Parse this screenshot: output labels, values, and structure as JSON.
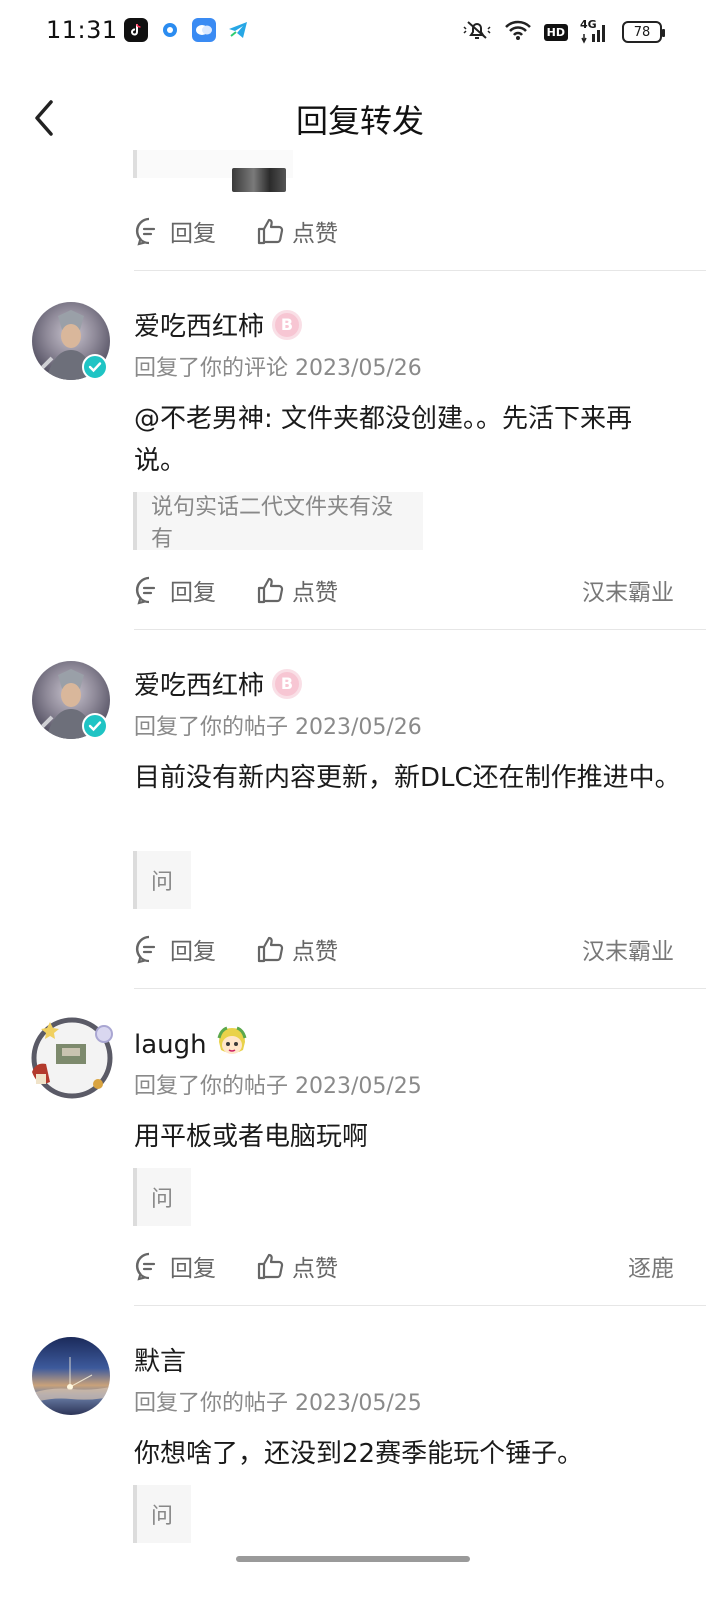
{
  "status_bar": {
    "time": "11:31",
    "network": "4G",
    "hd": "HD",
    "battery": "78",
    "app_icons": [
      "tiktok-icon",
      "browser-icon",
      "chat-icon",
      "telegram-icon"
    ]
  },
  "header": {
    "title": "回复转发"
  },
  "actions": {
    "reply_label": "回复",
    "like_label": "点赞"
  },
  "items": [
    {
      "username": "爱吃西红柿",
      "badge": "B",
      "verified": true,
      "meta": "回复了你的评论 2023/05/26",
      "content": "@不老男神: 文件夹都没创建。。先活下来再说。",
      "quote": "说句实话二代文件夹有没有",
      "source": "汉末霸业"
    },
    {
      "username": "爱吃西红柿",
      "badge": "B",
      "verified": true,
      "meta": "回复了你的帖子 2023/05/26",
      "content": "目前没有新内容更新，新DLC还在制作推进中。",
      "quote": "问",
      "source": "汉末霸业"
    },
    {
      "username": "laugh",
      "verified": false,
      "meta": "回复了你的帖子 2023/05/25",
      "content": "用平板或者电脑玩啊",
      "quote": "问",
      "source": "逐鹿"
    },
    {
      "username": "默言",
      "verified": false,
      "meta": "回复了你的帖子 2023/05/25",
      "content": "你想啥了，还没到22赛季能玩个锤子。",
      "quote": "问"
    }
  ],
  "colors": {
    "accent_verified": "#1fc4c4",
    "text_secondary": "#8a8a8a",
    "divider": "#e6e6e6"
  }
}
